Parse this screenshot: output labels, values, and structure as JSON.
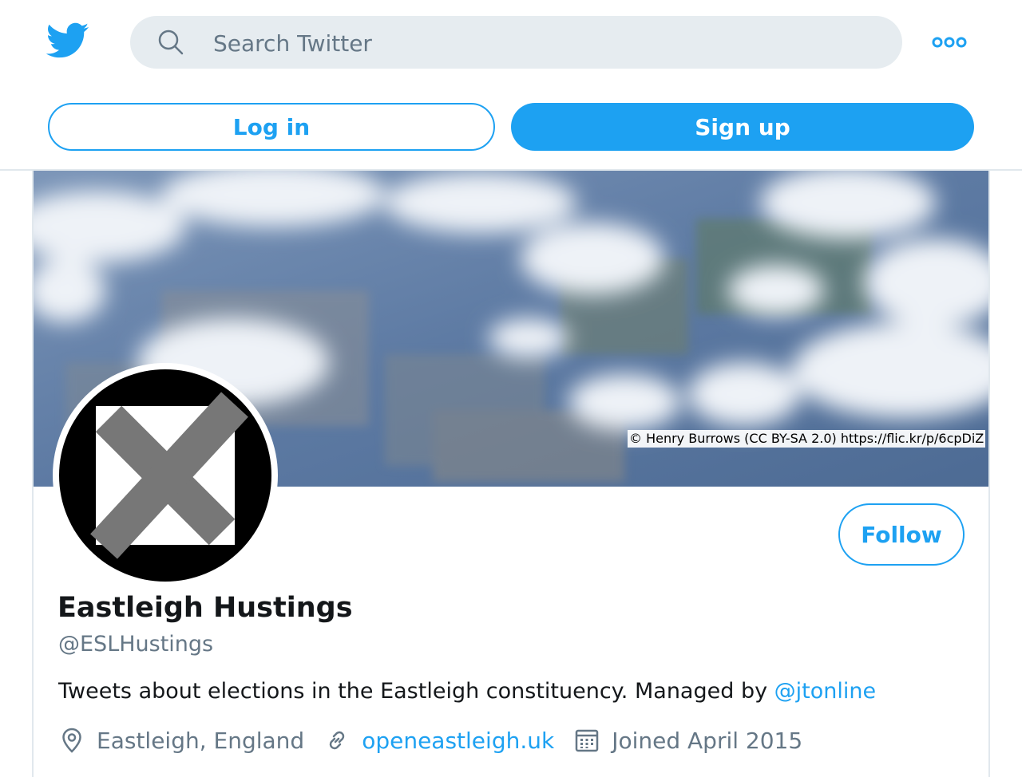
{
  "header": {
    "logo_icon": "twitter-bird-icon",
    "search": {
      "placeholder": "Search Twitter",
      "icon": "search-icon"
    },
    "more_icon": "more-options-icon",
    "login_label": "Log in",
    "signup_label": "Sign up"
  },
  "profile": {
    "banner_credit": "© Henry Burrows (CC BY-SA 2.0) https://flic.kr/p/6cpDiZ",
    "follow_label": "Follow",
    "name": "Eastleigh Hustings",
    "handle": "@ESLHustings",
    "bio_text": "Tweets about elections in the Eastleigh constituency. Managed by ",
    "bio_link": "@jtonline",
    "location": "Eastleigh, England",
    "website": "openeastleigh.uk",
    "joined": "Joined April 2015"
  },
  "colors": {
    "accent": "#1da1f2",
    "secondary_text": "#657786",
    "primary_text": "#14171a",
    "search_bg": "#e6ecf0"
  }
}
